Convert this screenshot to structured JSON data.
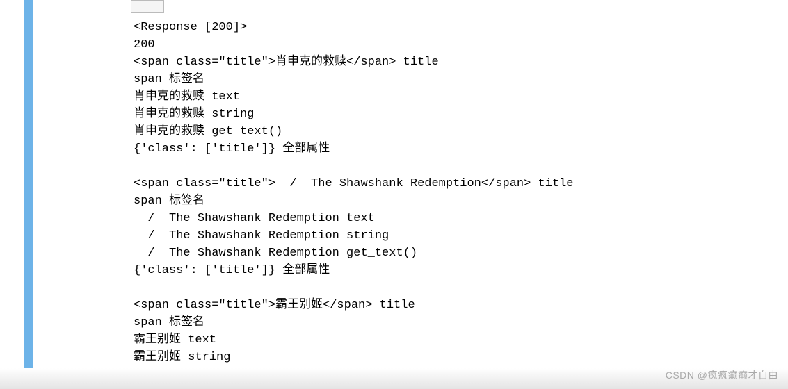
{
  "console": {
    "lines": [
      "<Response [200]>",
      "200",
      "<span class=\"title\">肖申克的救赎</span> title",
      "span 标签名",
      "肖申克的救赎 text",
      "肖申克的救赎 string",
      "肖申克的救赎 get_text()",
      "{'class': ['title']} 全部属性",
      "",
      "<span class=\"title\">  /  The Shawshank Redemption</span> title",
      "span 标签名",
      "  /  The Shawshank Redemption text",
      "  /  The Shawshank Redemption string",
      "  /  The Shawshank Redemption get_text()",
      "{'class': ['title']} 全部属性",
      "",
      "<span class=\"title\">霸王别姬</span> title",
      "span 标签名",
      "霸王别姬 text",
      "霸王别姬 string"
    ]
  },
  "watermark": "CSDN @疯疯癫癫才自由"
}
